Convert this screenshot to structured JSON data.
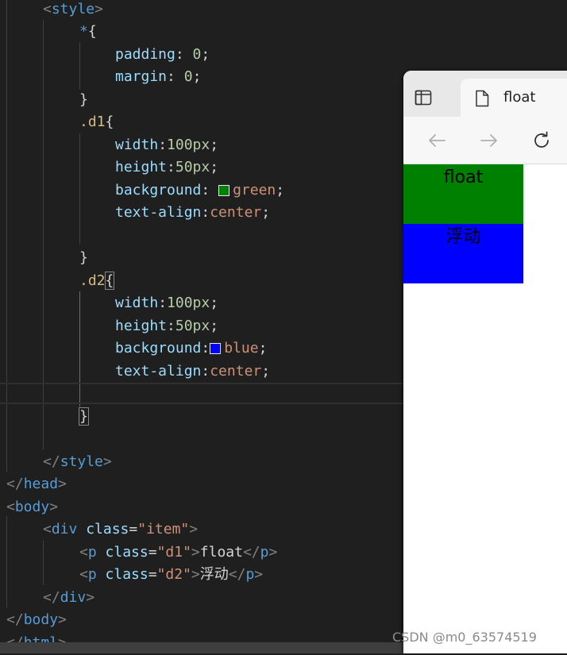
{
  "colors": {
    "d1_background": "#008000",
    "d2_background": "#0000ff"
  },
  "code": {
    "line1": {
      "open": "<",
      "tag": "style",
      "close": ">"
    },
    "line2": {
      "sel": "*",
      "brace": "{"
    },
    "line3": {
      "prop": "padding",
      "colon": ": ",
      "num": "0",
      "semi": ";"
    },
    "line4": {
      "prop": "margin",
      "colon": ": ",
      "num": "0",
      "semi": ";"
    },
    "line5": {
      "brace": "}"
    },
    "line6": {
      "sel": ".d1",
      "brace": "{"
    },
    "line7": {
      "prop": "width",
      "colon": ":",
      "num": "100px",
      "semi": ";"
    },
    "line8": {
      "prop": "height",
      "colon": ":",
      "num": "50px",
      "semi": ";"
    },
    "line9": {
      "prop": "background",
      "colon": ": ",
      "val": "green",
      "semi": ";"
    },
    "line10": {
      "prop": "text-align",
      "colon": ":",
      "val": "center",
      "semi": ";"
    },
    "line12": {
      "brace": "}"
    },
    "line13": {
      "sel": ".d2",
      "brace": "{"
    },
    "line14": {
      "prop": "width",
      "colon": ":",
      "num": "100px",
      "semi": ";"
    },
    "line15": {
      "prop": "height",
      "colon": ":",
      "num": "50px",
      "semi": ";"
    },
    "line16": {
      "prop": "background",
      "colon": ":",
      "val": "blue",
      "semi": ";"
    },
    "line17": {
      "prop": "text-align",
      "colon": ":",
      "val": "center",
      "semi": ";"
    },
    "line19": {
      "brace": "}"
    },
    "line21": {
      "open": "</",
      "tag": "style",
      "close": ">"
    },
    "line22": {
      "open": "</",
      "tag": "head",
      "close": ">"
    },
    "line23": {
      "open": "<",
      "tag": "body",
      "close": ">"
    },
    "line24": {
      "open": "<",
      "tag": "div",
      "attr": " class",
      "eq": "=",
      "str": "\"item\"",
      "close": ">"
    },
    "line25": {
      "open": "<",
      "tag": "p",
      "attr": " class",
      "eq": "=",
      "str": "\"d1\"",
      "close": ">",
      "text": "float",
      "eopen": "</",
      "etag": "p",
      "eclose": ">"
    },
    "line26": {
      "open": "<",
      "tag": "p",
      "attr": " class",
      "eq": "=",
      "str": "\"d2\"",
      "close": ">",
      "text": "浮动",
      "eopen": "</",
      "etag": "p",
      "eclose": ">"
    },
    "line27": {
      "open": "</",
      "tag": "div",
      "close": ">"
    },
    "line28": {
      "open": "</",
      "tag": "body",
      "close": ">"
    },
    "line29": {
      "open": "</",
      "tag": "html",
      "close": ">"
    }
  },
  "browser": {
    "tab_title": "float",
    "page": {
      "d1_text": "float",
      "d2_text": "浮动"
    }
  },
  "watermark": "CSDN @m0_63574519"
}
